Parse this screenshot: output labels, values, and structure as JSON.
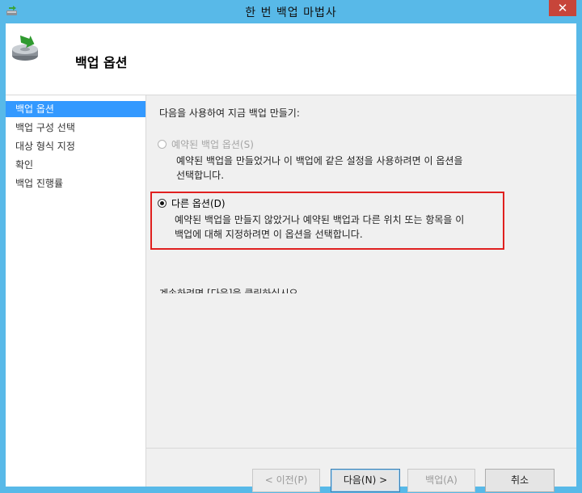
{
  "window": {
    "title": "한 번 백업 마법사",
    "close_label": "✕"
  },
  "header": {
    "title": "백업 옵션"
  },
  "nav": {
    "items": [
      {
        "label": "백업 옵션",
        "active": true
      },
      {
        "label": "백업 구성 선택"
      },
      {
        "label": "대상 형식 지정"
      },
      {
        "label": "확인"
      },
      {
        "label": "백업 진행률"
      }
    ]
  },
  "main": {
    "instruction": "다음을 사용하여 지금 백업 만들기:",
    "option_scheduled": {
      "label": "예약된 백업 옵션(S)",
      "description_line1": "예약된 백업을 만들었거나 이 백업에 같은 설정을 사용하려면 이 옵션을",
      "description_line2": "선택합니다.",
      "selected": false,
      "enabled": false
    },
    "option_different": {
      "label": "다른 옵션(D)",
      "description_line1": "예약된 백업을 만들지 않았거나 예약된 백업과 다른 위치 또는 항목을 이",
      "description_line2": "백업에 대해 지정하려면 이 옵션을 선택합니다.",
      "selected": true,
      "enabled": true
    },
    "continue_text": "계속하려면 [다음]을 클릭하십시오"
  },
  "buttons": {
    "prev": "< 이전(P)",
    "next": "다음(N) >",
    "backup": "백업(A)",
    "cancel": "취소"
  },
  "colors": {
    "title_bar": "#58b9e8",
    "close_button": "#c7453a",
    "nav_active": "#3399ff",
    "highlight_box": "#e0201f"
  }
}
